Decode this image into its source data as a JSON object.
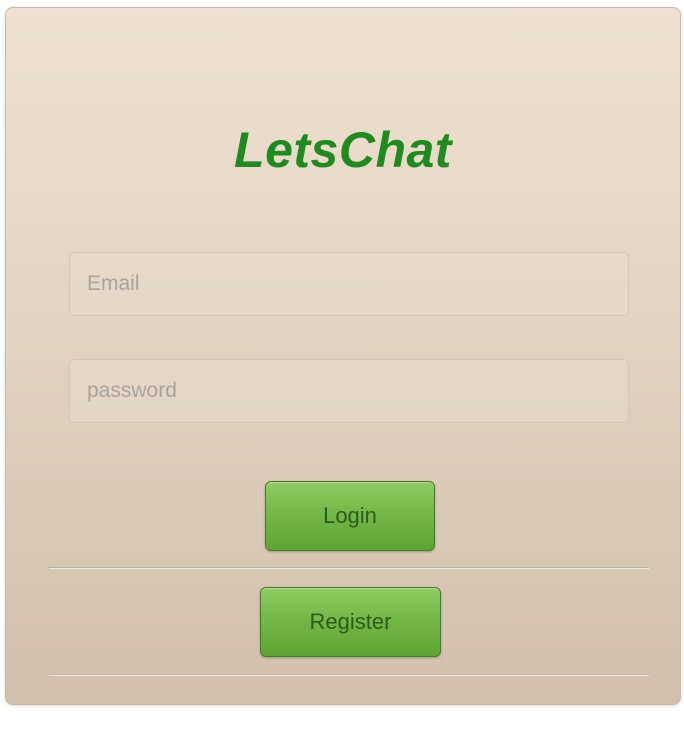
{
  "app": {
    "title": "LetsChat"
  },
  "form": {
    "email_placeholder": "Email",
    "password_placeholder": "password",
    "login_label": "Login",
    "register_label": "Register"
  },
  "colors": {
    "brand": "#1f8a1f",
    "button_green": "#6fb444",
    "panel_background": "#e3d3c2"
  }
}
